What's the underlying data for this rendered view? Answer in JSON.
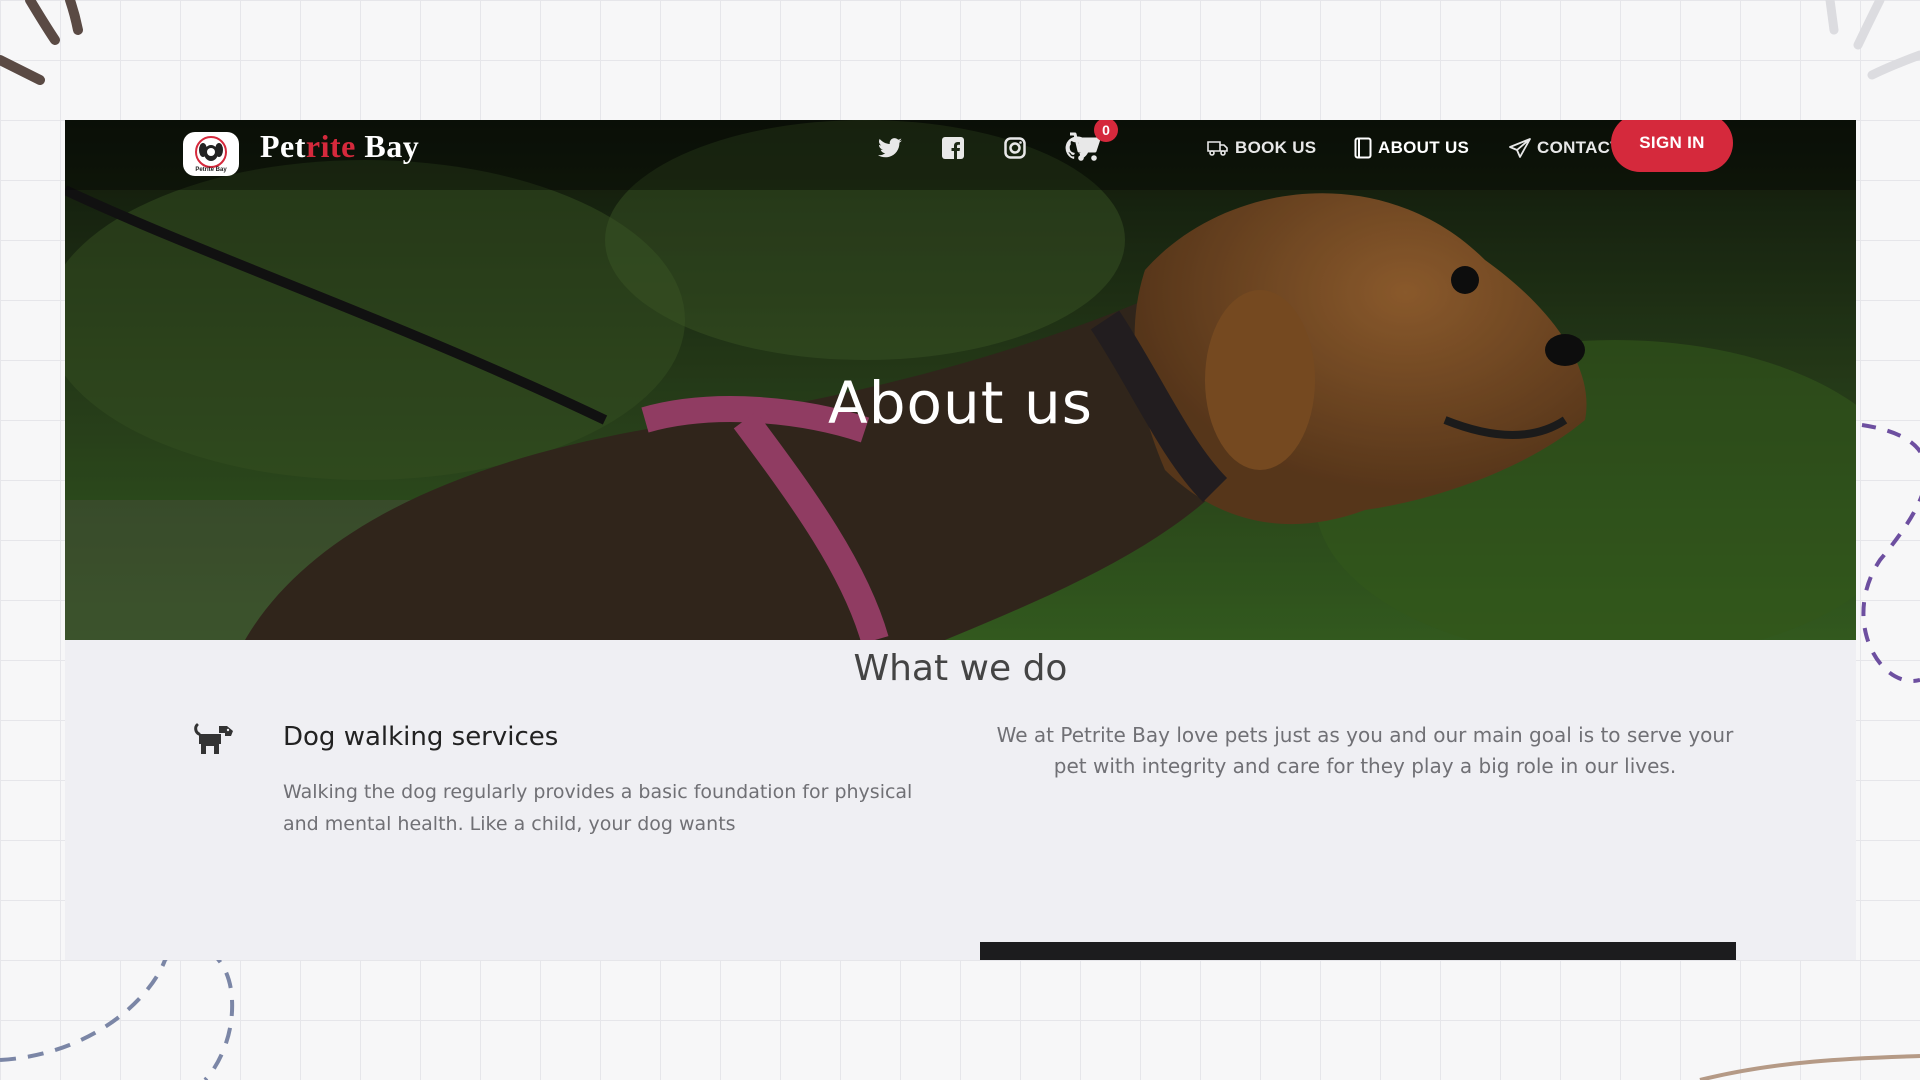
{
  "brand": {
    "prefix": "Pet",
    "accent": "rite",
    "suffix": " Bay",
    "logo_caption": "Petrite Bay"
  },
  "nav": {
    "social": [
      "twitter-icon",
      "facebook-icon",
      "instagram-icon",
      "github-icon"
    ],
    "cart_count": "0",
    "links": [
      {
        "label": "BOOK US",
        "icon": "truck-icon"
      },
      {
        "label": "ABOUT US",
        "icon": "book-icon",
        "active": true
      },
      {
        "label": "CONTACT US",
        "icon": "paper-plane-icon"
      }
    ],
    "signin_label": "SIGN IN"
  },
  "hero": {
    "title": "About us"
  },
  "section": {
    "title": "What we do",
    "service": {
      "icon": "dog-icon",
      "title": "Dog walking services",
      "text": "Walking the dog regularly provides a basic foundation for physical and mental health. Like a child, your dog wants"
    },
    "intro": "We at Petrite Bay love pets just as you and our main goal is to serve your pet with integrity and care for they play a big role in our lives."
  },
  "colors": {
    "accent": "#d5293c",
    "background": "#efeff3"
  }
}
